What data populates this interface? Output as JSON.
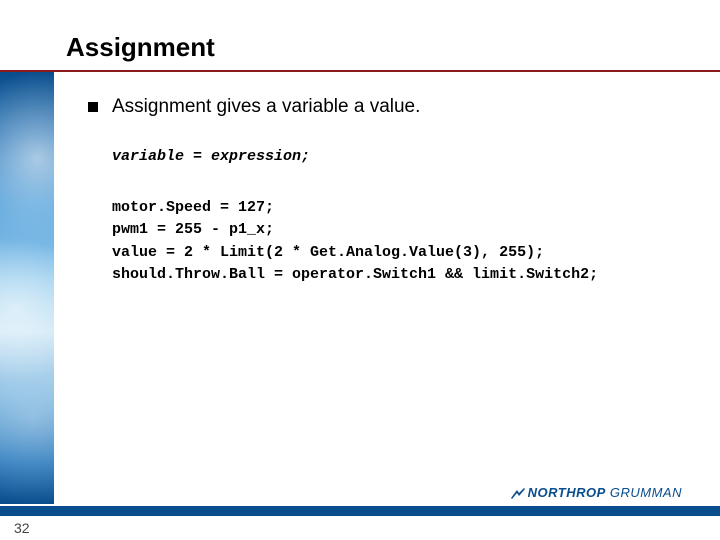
{
  "title": "Assignment",
  "bullet": "Assignment gives a variable a value.",
  "syntax": "variable = expression;",
  "code": "motor.Speed = 127;\npwm1 = 255 - p1_x;\nvalue = 2 * Limit(2 * Get.Analog.Value(3), 255);\nshould.Throw.Ball = operator.Switch1 && limit.Switch2;",
  "page_number": "32",
  "logo": {
    "part1": "NORTHROP",
    "part2": "GRUMMAN"
  }
}
